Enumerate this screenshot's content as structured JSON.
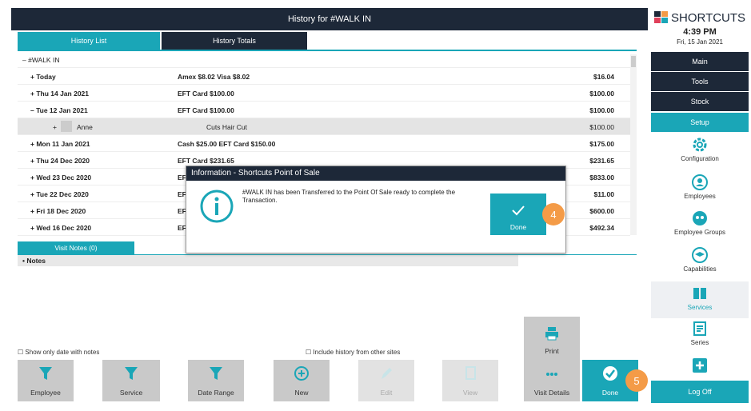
{
  "window": {
    "title": "History for #WALK IN"
  },
  "tabs": {
    "list": "History List",
    "totals": "History Totals"
  },
  "history": {
    "root": "– #WALK IN",
    "rows": [
      {
        "date": "+ Today",
        "summary": "Amex $8.02 Visa $8.02",
        "amount": "$16.04"
      },
      {
        "date": "+ Thu 14 Jan 2021",
        "summary": "EFT Card $100.00",
        "amount": "$100.00"
      },
      {
        "date": "– Tue 12 Jan 2021",
        "summary": "EFT Card $100.00",
        "amount": "$100.00"
      },
      {
        "date": "+ Mon 11 Jan 2021",
        "summary": "Cash $25.00 EFT Card $150.00",
        "amount": "$175.00"
      },
      {
        "date": "+ Thu 24 Dec 2020",
        "summary": "EFT Card $231.65",
        "amount": "$231.65"
      },
      {
        "date": "+ Wed 23 Dec 2020",
        "summary": "EF",
        "amount": "$833.00"
      },
      {
        "date": "+ Tue 22 Dec 2020",
        "summary": "EF",
        "amount": "$11.00"
      },
      {
        "date": "+ Fri 18 Dec 2020",
        "summary": "EF",
        "amount": "$600.00"
      },
      {
        "date": "+ Wed 16 Dec 2020",
        "summary": "EF",
        "amount": "$492.34"
      }
    ],
    "sub_row": {
      "name": "Anne",
      "service": "Cuts Hair Cut",
      "amount": "$100.00"
    }
  },
  "notes": {
    "tab": "Visit Notes (0)",
    "header": "• Notes"
  },
  "checks": {
    "only_notes": "Show only date with notes",
    "other_sites": "Include history from other sites"
  },
  "toolbar": {
    "employee": "Employee",
    "service": "Service",
    "date_range": "Date Range",
    "new": "New",
    "edit": "Edit",
    "view": "View",
    "visit_details": "Visit Details",
    "done": "Done",
    "print": "Print"
  },
  "dialog": {
    "title": "Information - Shortcuts Point of Sale",
    "message": "#WALK IN has been Transferred to the Point Of Sale ready to complete the Transaction.",
    "done": "Done"
  },
  "badges": {
    "b4": "4",
    "b5": "5"
  },
  "sidebar": {
    "brand": "SHORTCUTS",
    "time": "4:39 PM",
    "date": "Fri, 15 Jan 2021",
    "menu": {
      "main": "Main",
      "tools": "Tools",
      "stock": "Stock",
      "setup": "Setup"
    },
    "icons": {
      "configuration": "Configuration",
      "employees": "Employees",
      "employee_groups": "Employee Groups",
      "capabilities": "Capabilities",
      "services": "Services",
      "series": "Series"
    },
    "logoff": "Log Off"
  },
  "colors": {
    "accent": "#1aa6b7",
    "dark": "#1d2838",
    "badge": "#f49b47"
  }
}
